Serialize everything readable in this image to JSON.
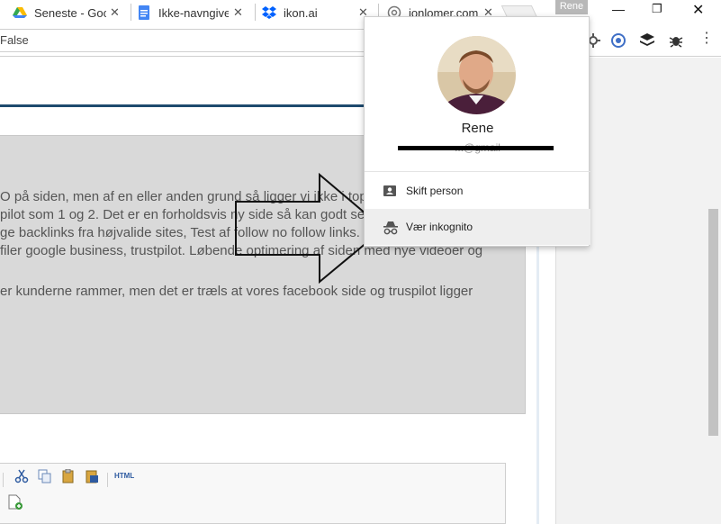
{
  "tabs": [
    {
      "title": "Seneste - Goo",
      "favicon": "google-drive-icon"
    },
    {
      "title": "Ikke-navngivet",
      "favicon": "google-docs-icon"
    },
    {
      "title": "ikon.ai",
      "favicon": "dropbox-icon"
    },
    {
      "title": "jonlomer.com",
      "favicon": "globe-icon"
    }
  ],
  "window": {
    "profile_chip": "Rene"
  },
  "address_bar": {
    "value": "False"
  },
  "page": {
    "paragraphs": [
      "O på siden, men af en eller anden grund så ligger vi ikke i top",
      "pilot som 1 og 2. Det er en forholdsvis ny side så kan godt se",
      "ge backlinks fra højvalide sites, Test af follow no follow links.",
      " filer google business, trustpilot. Løbende optimering af siden med nye videoer og",
      "er kunderne rammer, men det er træls at vores facebook side og truspilot ligger"
    ],
    "toolbar": {
      "html_label": "HTML"
    }
  },
  "profile_menu": {
    "name": "Rene",
    "email_partial": "...@gmail",
    "items": [
      {
        "label": "Skift person",
        "icon": "person-card-icon"
      },
      {
        "label": "Vær inkognito",
        "icon": "incognito-icon"
      }
    ]
  },
  "colors": {
    "accent_rule": "#1e4a6e",
    "content_bg": "#d9d9d9",
    "menu_hover": "#eeeeee"
  }
}
